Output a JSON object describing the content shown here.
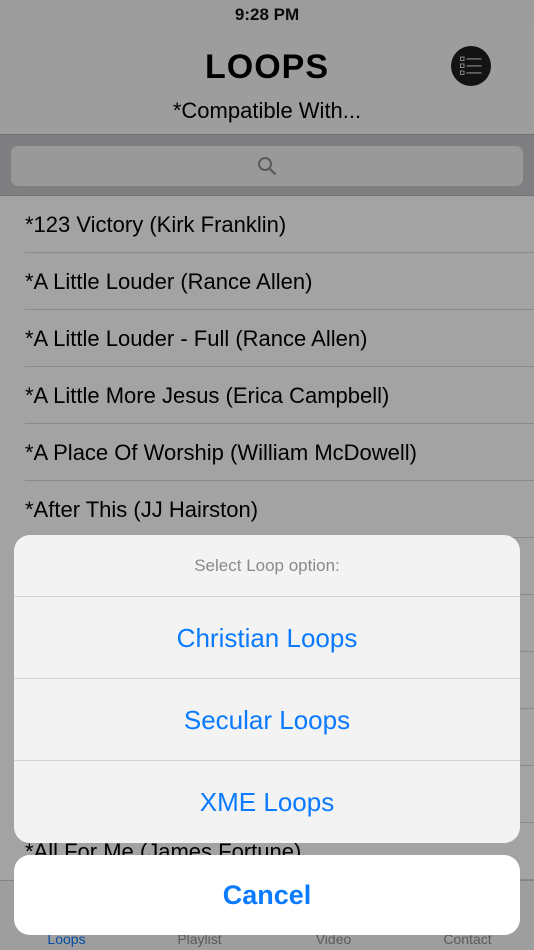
{
  "status_bar": {
    "time": "9:28 PM"
  },
  "header": {
    "title": "LOOPS",
    "subtitle": "*Compatible With...",
    "menu_icon": "list-icon"
  },
  "search": {
    "icon": "search-icon",
    "placeholder": ""
  },
  "list": {
    "items": [
      "*123 Victory (Kirk Franklin)",
      "*A Little Louder (Rance Allen)",
      "*A Little Louder - Full (Rance Allen)",
      "*A Little More Jesus (Erica Campbell)",
      "*A Place Of Worship (William McDowell)",
      "*After This (JJ Hairston)",
      "",
      "",
      "",
      "",
      "",
      "*All For Me (James Fortune)"
    ]
  },
  "tabs": [
    {
      "label": "Loops",
      "active": true
    },
    {
      "label": "Playlist",
      "active": false
    },
    {
      "label": "Video",
      "active": false
    },
    {
      "label": "Contact",
      "active": false
    }
  ],
  "action_sheet": {
    "title": "Select Loop option:",
    "options": [
      "Christian Loops",
      "Secular Loops",
      "XME Loops"
    ],
    "cancel_label": "Cancel"
  },
  "colors": {
    "accent": "#0a7aff",
    "menu_button": "#1e1e1e"
  }
}
